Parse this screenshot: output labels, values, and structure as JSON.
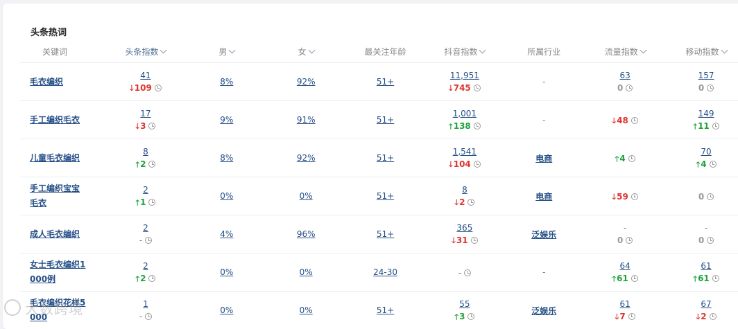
{
  "section_title": "头条热词",
  "columns": {
    "keyword": "关键词",
    "toutiao_index": "头条指数",
    "male": "男",
    "female": "女",
    "age": "最关注年龄",
    "douyin_index": "抖音指数",
    "industry": "所属行业",
    "traffic_index": "流量指数",
    "mobile_index": "移动指数"
  },
  "rows": [
    {
      "keyword": [
        "毛衣编织"
      ],
      "toutiao": {
        "value": "41",
        "change": "109",
        "dir": "down"
      },
      "male": "8%",
      "female": "92%",
      "age": "51+",
      "douyin": {
        "value": "11,951",
        "change": "745",
        "dir": "down"
      },
      "industry": "-",
      "traffic": {
        "value": "63",
        "change": "0",
        "dir": "zero"
      },
      "mobile": {
        "value": "157",
        "change": "0",
        "dir": "zero"
      }
    },
    {
      "keyword": [
        "手工编织毛衣"
      ],
      "toutiao": {
        "value": "17",
        "change": "3",
        "dir": "down"
      },
      "male": "9%",
      "female": "91%",
      "age": "51+",
      "douyin": {
        "value": "1,001",
        "change": "138",
        "dir": "up"
      },
      "industry": "-",
      "traffic": {
        "value": "",
        "change": "48",
        "dir": "down"
      },
      "mobile": {
        "value": "149",
        "change": "11",
        "dir": "up"
      }
    },
    {
      "keyword": [
        "儿童毛衣编织"
      ],
      "toutiao": {
        "value": "8",
        "change": "2",
        "dir": "up"
      },
      "male": "8%",
      "female": "92%",
      "age": "51+",
      "douyin": {
        "value": "1,541",
        "change": "104",
        "dir": "down"
      },
      "industry": "电商",
      "traffic": {
        "value": "",
        "change": "4",
        "dir": "up"
      },
      "mobile": {
        "value": "70",
        "change": "4",
        "dir": "up"
      }
    },
    {
      "keyword": [
        "手工编织宝宝",
        "毛衣"
      ],
      "toutiao": {
        "value": "2",
        "change": "1",
        "dir": "up"
      },
      "male": "0%",
      "female": "0%",
      "age": "51+",
      "douyin": {
        "value": "8",
        "change": "2",
        "dir": "down"
      },
      "industry": "电商",
      "traffic": {
        "value": "",
        "change": "59",
        "dir": "down"
      },
      "mobile": {
        "value": "",
        "change": "0",
        "dir": "zero"
      }
    },
    {
      "keyword": [
        "成人毛衣编织"
      ],
      "toutiao": {
        "value": "2",
        "change": "-",
        "dir": "dash"
      },
      "male": "4%",
      "female": "96%",
      "age": "51+",
      "douyin": {
        "value": "365",
        "change": "31",
        "dir": "down"
      },
      "industry": "泛娱乐",
      "traffic": {
        "value": "-",
        "change": "0",
        "dir": "zero"
      },
      "mobile": {
        "value": "-",
        "change": "0",
        "dir": "zero"
      }
    },
    {
      "keyword": [
        "女士毛衣编织1",
        "000例"
      ],
      "toutiao": {
        "value": "2",
        "change": "2",
        "dir": "up"
      },
      "male": "0%",
      "female": "0%",
      "age": "24-30",
      "douyin": {
        "value": "",
        "change": "-",
        "dir": "dash"
      },
      "industry": "-",
      "traffic": {
        "value": "64",
        "change": "61",
        "dir": "up"
      },
      "mobile": {
        "value": "61",
        "change": "61",
        "dir": "up"
      }
    },
    {
      "keyword": [
        "毛衣编织花样5",
        "000"
      ],
      "toutiao": {
        "value": "1",
        "change": "-",
        "dir": "dash"
      },
      "male": "0%",
      "female": "0%",
      "age": "51+",
      "douyin": {
        "value": "55",
        "change": "3",
        "dir": "up"
      },
      "industry": "泛娱乐",
      "traffic": {
        "value": "61",
        "change": "7",
        "dir": "down"
      },
      "mobile": {
        "value": "67",
        "change": "2",
        "dir": "down"
      }
    }
  ],
  "watermark": "大数跨境",
  "colors": {
    "link": "#254f87",
    "up": "#1fa23a",
    "down": "#e0332f",
    "header_sort": "#4f6f95"
  }
}
